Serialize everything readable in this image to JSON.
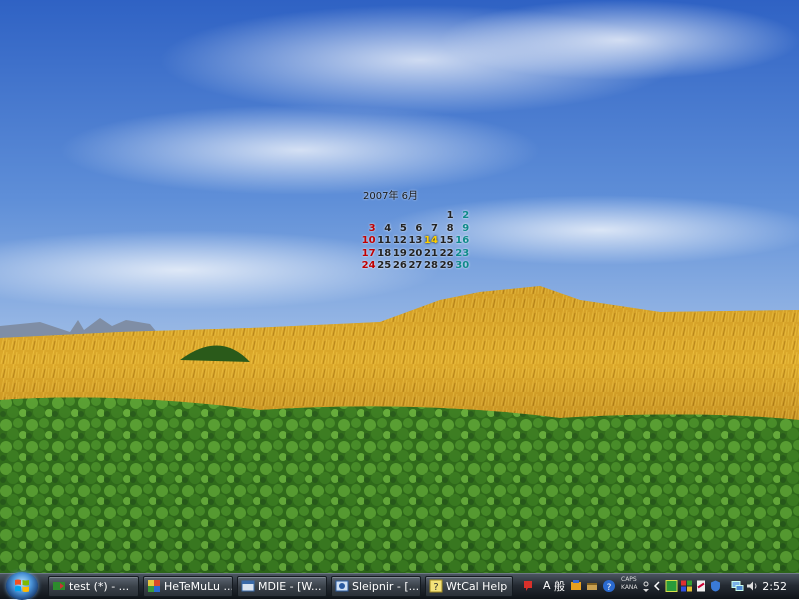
{
  "calendar": {
    "title": "2007年 6月",
    "weeks": [
      [
        "",
        "",
        "",
        "",
        "",
        "1",
        "2"
      ],
      [
        "3",
        "4",
        "5",
        "6",
        "7",
        "8",
        "9"
      ],
      [
        "10",
        "11",
        "12",
        "13",
        "14",
        "15",
        "16"
      ],
      [
        "17",
        "18",
        "19",
        "20",
        "21",
        "22",
        "23"
      ],
      [
        "24",
        "25",
        "26",
        "27",
        "28",
        "29",
        "30"
      ]
    ],
    "today": "14"
  },
  "taskbar": {
    "tasks": [
      {
        "label": "test (*) - ...",
        "icon": "editor-icon"
      },
      {
        "label": "HeTeMuLu ...",
        "icon": "hetemulu-icon"
      },
      {
        "label": "MDIE - [W...",
        "icon": "mdie-icon"
      },
      {
        "label": "Sleipnir - [...",
        "icon": "sleipnir-icon"
      },
      {
        "label": "WtCal Help",
        "icon": "help-icon"
      }
    ],
    "tray": {
      "ime_mode": "A",
      "ime_kanji": "般",
      "caps": "CAPS",
      "kana": "KANA",
      "clock": "2:52"
    }
  },
  "colors": {
    "sunday": "#c00000",
    "saturday": "#0e8a8a",
    "today": "#ffd000",
    "taskbar": "#252b33"
  }
}
